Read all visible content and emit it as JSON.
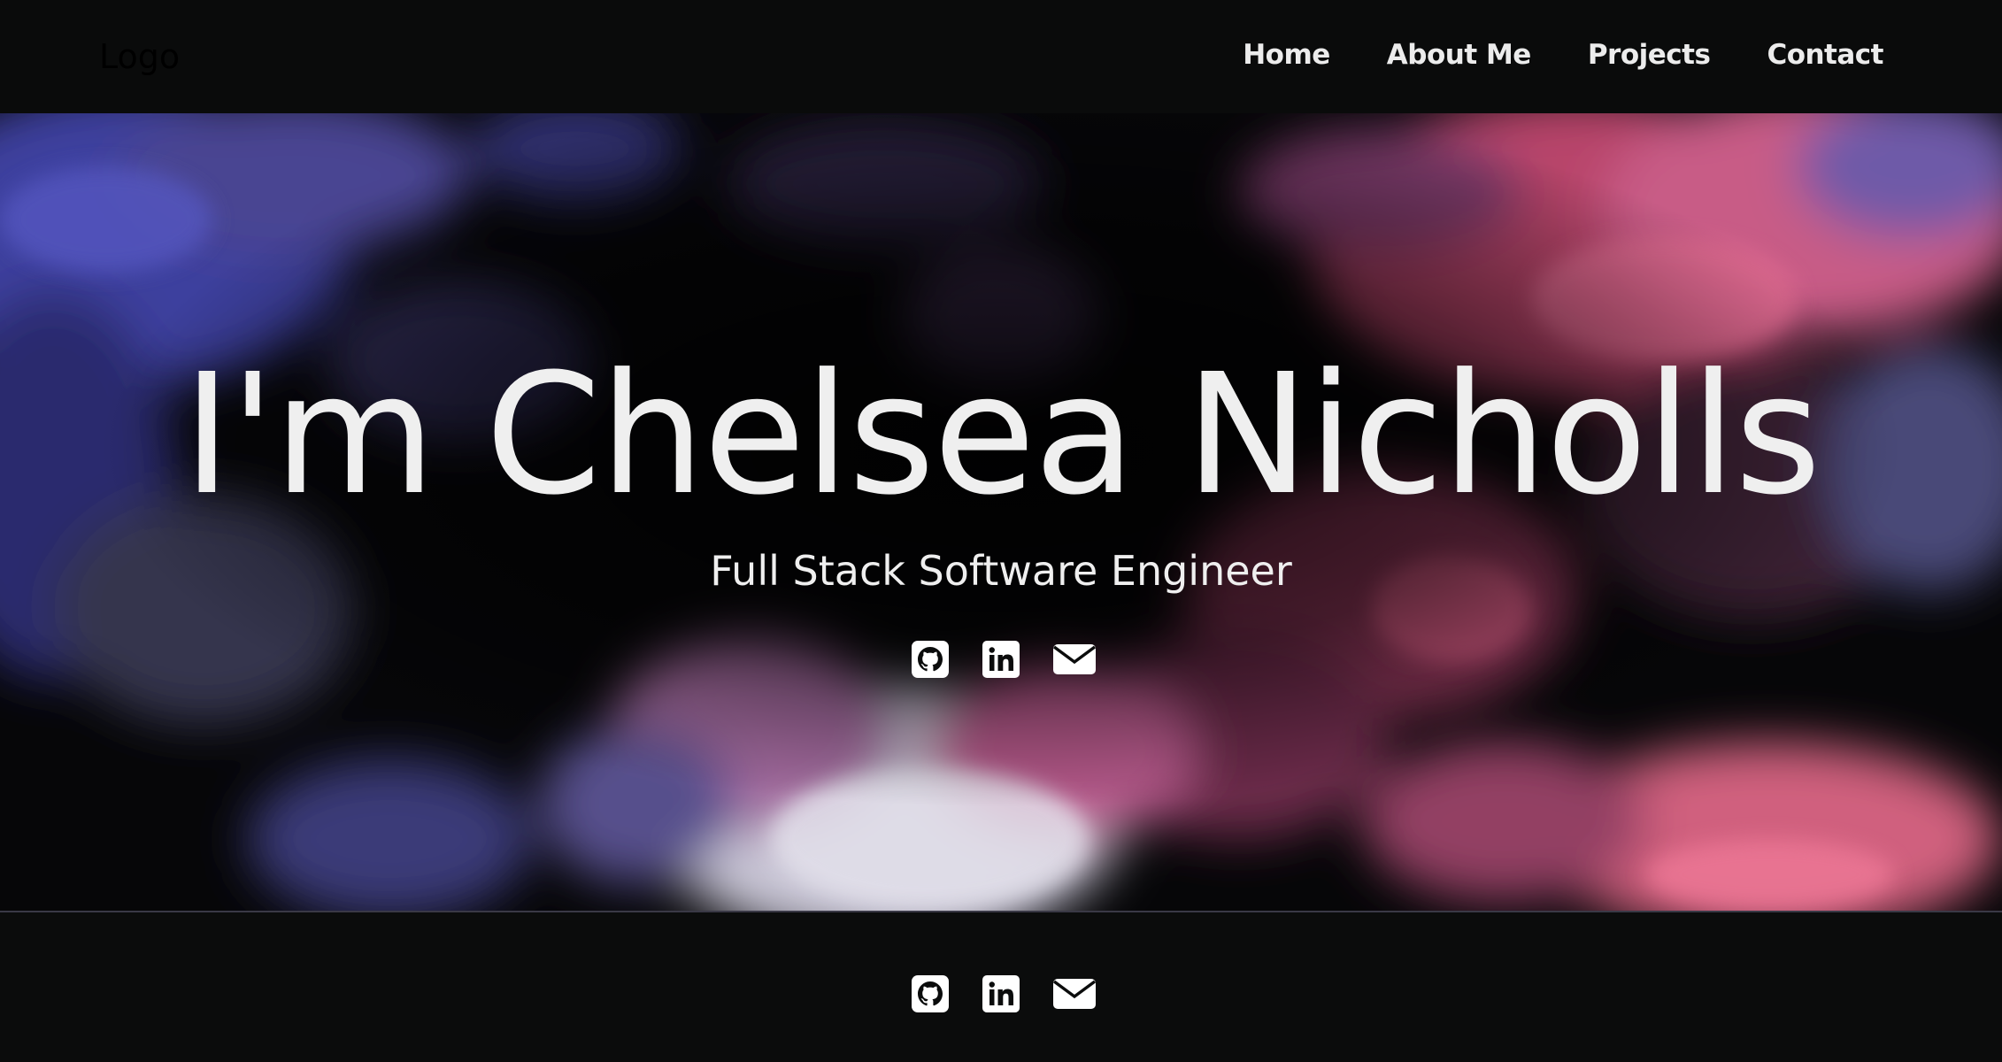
{
  "nav": {
    "logo": "Logo",
    "links": [
      "Home",
      "About Me",
      "Projects",
      "Contact"
    ]
  },
  "hero": {
    "title": "I'm Chelsea Nicholls",
    "subtitle": "Full Stack Software Engineer"
  },
  "social_icons": [
    "github-icon",
    "linkedin-icon",
    "envelope-icon"
  ],
  "colors": {
    "background": "#0b0c0c",
    "text": "#efefef",
    "accent_pink": "#e0567a",
    "accent_blue": "#3a3ea8"
  }
}
